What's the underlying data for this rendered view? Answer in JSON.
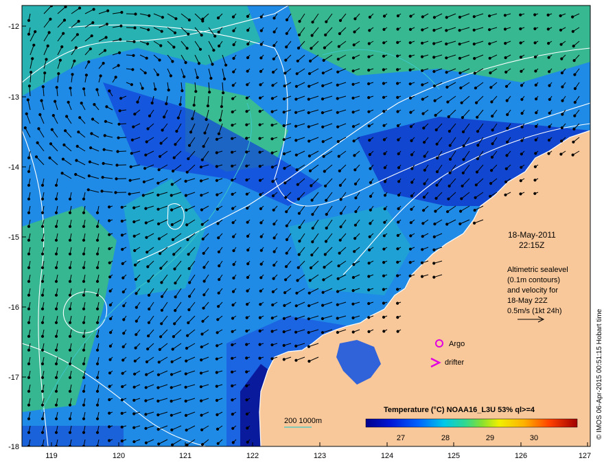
{
  "map": {
    "lat_ticks": [
      "-12",
      "-13",
      "-14",
      "-15",
      "-16",
      "-17",
      "-18"
    ],
    "lon_ticks": [
      "119",
      "120",
      "121",
      "122",
      "123",
      "124",
      "125",
      "126",
      "127"
    ]
  },
  "annotation": {
    "date": "18-May-2011",
    "time": "22:15Z",
    "alt_line1": "Altimetric sealevel",
    "alt_line2": "(0.1m contours)",
    "alt_line3": "and velocity for",
    "alt_line4": "18-May 22Z",
    "scale_label": "0.5m/s (1kt 24h)"
  },
  "legend": {
    "argo": "Argo",
    "drifter": "drifter",
    "depth": "200  1000m",
    "colorbar_title": "Temperature (°C) NOAA16_L3U 53% ql>=4",
    "colorbar_ticks": [
      "27",
      "28",
      "29",
      "30"
    ]
  },
  "credit": "© IMOS 06-Apr-2015 00:51:15 Hobart time",
  "colors": {
    "land": "#f9c89a",
    "argo": "#e000e0",
    "drifter": "#e000e0",
    "depth_contour": "#3cc8c8"
  }
}
